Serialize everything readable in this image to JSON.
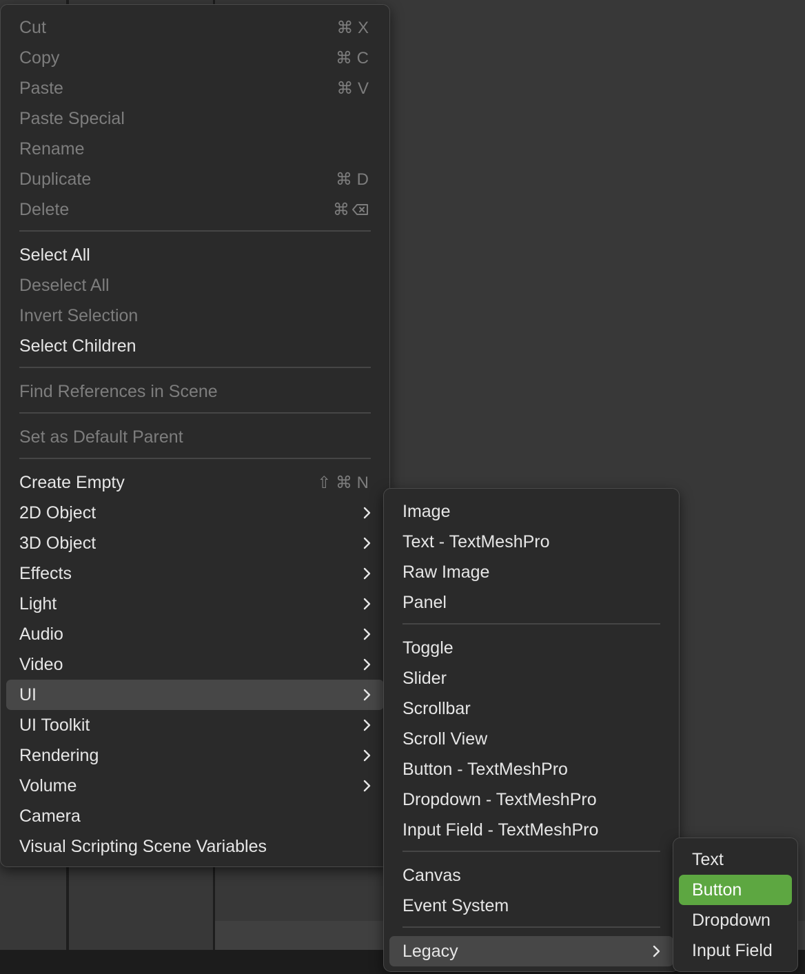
{
  "main_menu": {
    "group1": [
      {
        "label": "Cut",
        "shortcut": "⌘ X"
      },
      {
        "label": "Copy",
        "shortcut": "⌘ C"
      },
      {
        "label": "Paste",
        "shortcut": "⌘ V"
      },
      {
        "label": "Paste Special",
        "shortcut": ""
      },
      {
        "label": "Rename",
        "shortcut": ""
      },
      {
        "label": "Duplicate",
        "shortcut": "⌘ D"
      },
      {
        "label": "Delete",
        "shortcut": "⌘"
      }
    ],
    "group2": [
      {
        "label": "Select All"
      },
      {
        "label": "Deselect All"
      },
      {
        "label": "Invert Selection"
      },
      {
        "label": "Select Children"
      }
    ],
    "find_references": "Find References in Scene",
    "set_default_parent": "Set as Default Parent",
    "create_empty": {
      "label": "Create Empty",
      "shortcut": "⇧ ⌘ N"
    },
    "group3": [
      {
        "label": "2D Object"
      },
      {
        "label": "3D Object"
      },
      {
        "label": "Effects"
      },
      {
        "label": "Light"
      },
      {
        "label": "Audio"
      },
      {
        "label": "Video"
      },
      {
        "label": "UI"
      },
      {
        "label": "UI Toolkit"
      },
      {
        "label": "Rendering"
      },
      {
        "label": "Volume"
      },
      {
        "label": "Camera"
      },
      {
        "label": "Visual Scripting Scene Variables"
      }
    ]
  },
  "ui_submenu": {
    "items1": [
      "Image",
      "Text - TextMeshPro",
      "Raw Image",
      "Panel"
    ],
    "items2": [
      "Toggle",
      "Slider",
      "Scrollbar",
      "Scroll View",
      "Button - TextMeshPro",
      "Dropdown - TextMeshPro",
      "Input Field - TextMeshPro"
    ],
    "items3": [
      "Canvas",
      "Event System"
    ],
    "legacy": "Legacy"
  },
  "legacy_submenu": {
    "items": [
      "Text",
      "Button",
      "Dropdown",
      "Input Field"
    ]
  },
  "colors": {
    "background": "#383838",
    "menu_bg": "#2a2a2a",
    "highlight": "#474747",
    "active_accent": "#5da741",
    "text": "#e6e6e6",
    "disabled_text": "#7d7d7d"
  }
}
